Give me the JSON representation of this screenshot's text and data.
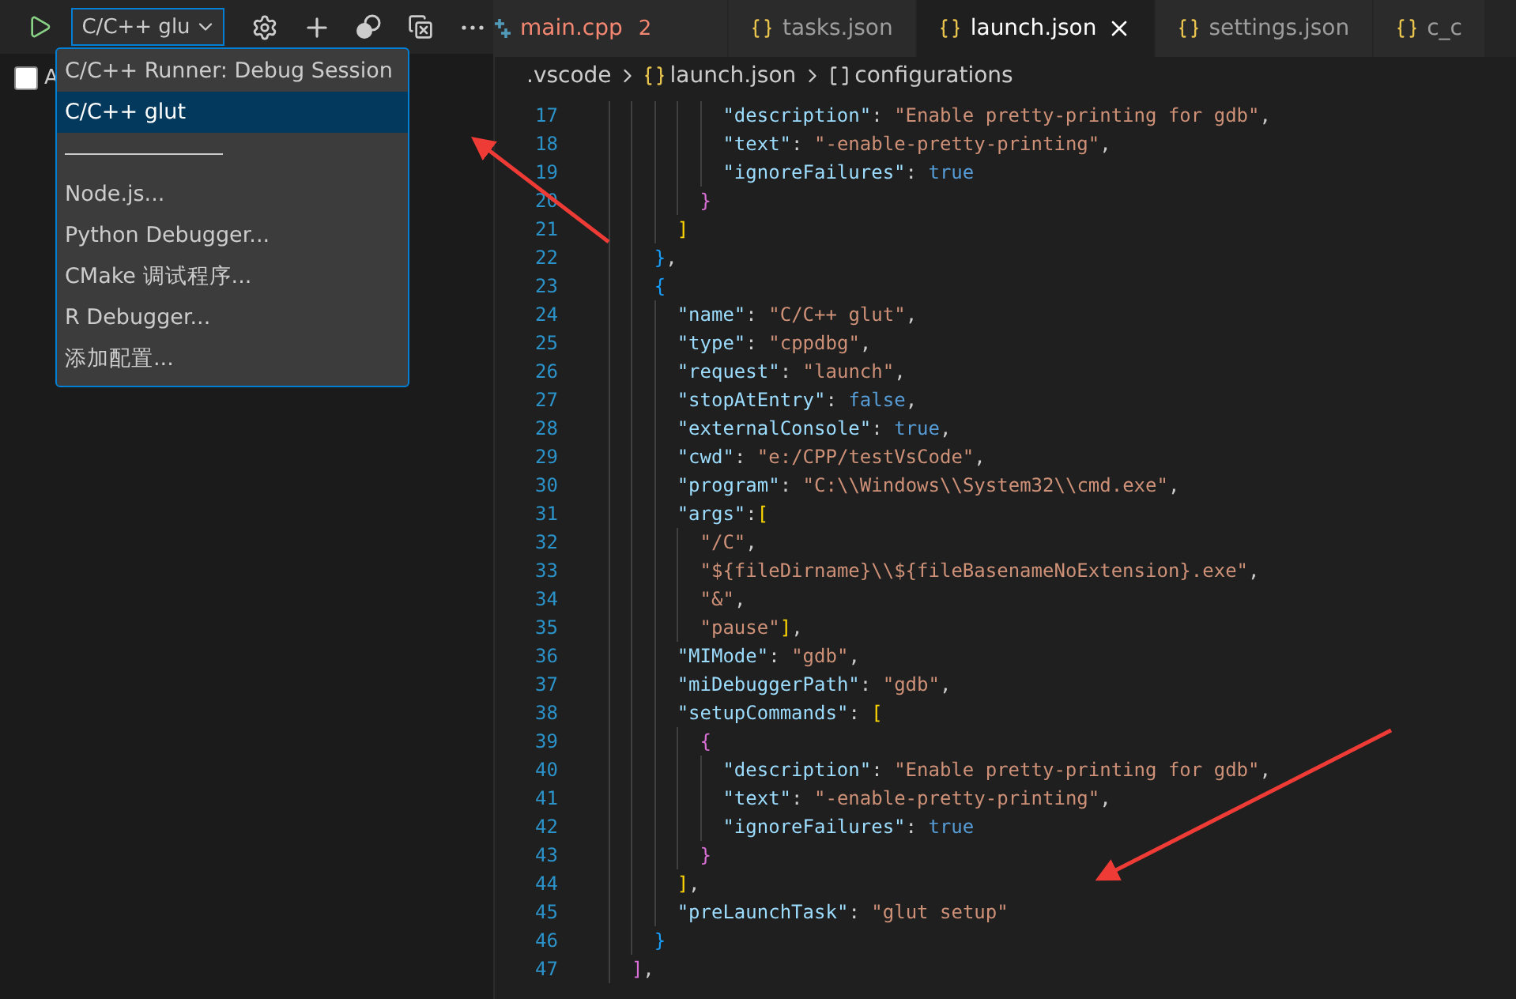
{
  "debug_toolbar": {
    "configuration": "C/C++ glu"
  },
  "sidebar": {
    "checkbox": {
      "label": "A",
      "checked": false
    }
  },
  "config_dropdown": {
    "items": [
      {
        "kind": "option",
        "label": "C/C++ Runner: Debug Session",
        "selected": false
      },
      {
        "kind": "option",
        "label": "C/C++ glut",
        "selected": true
      },
      {
        "kind": "separator"
      },
      {
        "kind": "option",
        "label": "Node.js...",
        "selected": false
      },
      {
        "kind": "option",
        "label": "Python Debugger...",
        "selected": false
      },
      {
        "kind": "option",
        "label": "CMake 调试程序...",
        "selected": false
      },
      {
        "kind": "option",
        "label": "R Debugger...",
        "selected": false
      },
      {
        "kind": "option",
        "label": "添加配置...",
        "selected": false
      }
    ]
  },
  "tabs": [
    {
      "kind": "cpp",
      "label": "main.cpp",
      "badge": "2",
      "error": true,
      "selected": false
    },
    {
      "kind": "json",
      "label": "tasks.json",
      "error": false,
      "selected": false
    },
    {
      "kind": "json",
      "label": "launch.json",
      "error": false,
      "selected": true
    },
    {
      "kind": "json",
      "label": "settings.json",
      "error": false,
      "selected": false
    },
    {
      "kind": "json",
      "label": "c_c",
      "error": false,
      "selected": false
    }
  ],
  "breadcrumb": [
    {
      "kind": "folder",
      "label": ".vscode"
    },
    {
      "kind": "json",
      "label": "launch.json"
    },
    {
      "kind": "array",
      "label": "configurations"
    }
  ],
  "editor": {
    "lines": [
      {
        "number": "17",
        "tokens": [
          {
            "kind": "key",
            "text": "          \"description\""
          },
          {
            "kind": "punct",
            "text": ": "
          },
          {
            "kind": "string",
            "text": "\"Enable pretty-printing for gdb\""
          },
          {
            "kind": "punct",
            "text": ","
          }
        ]
      },
      {
        "number": "18",
        "tokens": [
          {
            "kind": "key",
            "text": "          \"text\""
          },
          {
            "kind": "punct",
            "text": ": "
          },
          {
            "kind": "string",
            "text": "\"-enable-pretty-printing\""
          },
          {
            "kind": "punct",
            "text": ","
          }
        ]
      },
      {
        "number": "19",
        "tokens": [
          {
            "kind": "key",
            "text": "          \"ignoreFailures\""
          },
          {
            "kind": "punct",
            "text": ": "
          },
          {
            "kind": "keyword",
            "text": "true"
          }
        ]
      },
      {
        "number": "20",
        "tokens": [
          {
            "kind": "bracket2",
            "text": "        }"
          }
        ]
      },
      {
        "number": "21",
        "tokens": [
          {
            "kind": "bracket1",
            "text": "      ]"
          }
        ]
      },
      {
        "number": "22",
        "tokens": [
          {
            "kind": "bracket3",
            "text": "    }"
          },
          {
            "kind": "punct",
            "text": ","
          }
        ]
      },
      {
        "number": "23",
        "tokens": [
          {
            "kind": "bracket3",
            "text": "    {"
          }
        ]
      },
      {
        "number": "24",
        "tokens": [
          {
            "kind": "key",
            "text": "      \"name\""
          },
          {
            "kind": "punct",
            "text": ": "
          },
          {
            "kind": "string",
            "text": "\"C/C++ glut\""
          },
          {
            "kind": "punct",
            "text": ","
          }
        ]
      },
      {
        "number": "25",
        "tokens": [
          {
            "kind": "key",
            "text": "      \"type\""
          },
          {
            "kind": "punct",
            "text": ": "
          },
          {
            "kind": "string",
            "text": "\"cppdbg\""
          },
          {
            "kind": "punct",
            "text": ","
          }
        ]
      },
      {
        "number": "26",
        "tokens": [
          {
            "kind": "key",
            "text": "      \"request\""
          },
          {
            "kind": "punct",
            "text": ": "
          },
          {
            "kind": "string",
            "text": "\"launch\""
          },
          {
            "kind": "punct",
            "text": ","
          }
        ]
      },
      {
        "number": "27",
        "tokens": [
          {
            "kind": "key",
            "text": "      \"stopAtEntry\""
          },
          {
            "kind": "punct",
            "text": ": "
          },
          {
            "kind": "keyword",
            "text": "false"
          },
          {
            "kind": "punct",
            "text": ","
          }
        ]
      },
      {
        "number": "28",
        "tokens": [
          {
            "kind": "key",
            "text": "      \"externalConsole\""
          },
          {
            "kind": "punct",
            "text": ": "
          },
          {
            "kind": "keyword",
            "text": "true"
          },
          {
            "kind": "punct",
            "text": ","
          }
        ]
      },
      {
        "number": "29",
        "tokens": [
          {
            "kind": "key",
            "text": "      \"cwd\""
          },
          {
            "kind": "punct",
            "text": ": "
          },
          {
            "kind": "string",
            "text": "\"e:/CPP/testVsCode\""
          },
          {
            "kind": "punct",
            "text": ","
          }
        ]
      },
      {
        "number": "30",
        "tokens": [
          {
            "kind": "key",
            "text": "      \"program\""
          },
          {
            "kind": "punct",
            "text": ": "
          },
          {
            "kind": "string",
            "text": "\"C:\\\\Windows\\\\System32\\\\cmd.exe\""
          },
          {
            "kind": "punct",
            "text": ","
          }
        ]
      },
      {
        "number": "31",
        "tokens": [
          {
            "kind": "key",
            "text": "      \"args\""
          },
          {
            "kind": "punct",
            "text": ":"
          },
          {
            "kind": "bracket1",
            "text": "["
          }
        ]
      },
      {
        "number": "32",
        "tokens": [
          {
            "kind": "string",
            "text": "        \"/C\""
          },
          {
            "kind": "punct",
            "text": ","
          }
        ]
      },
      {
        "number": "33",
        "tokens": [
          {
            "kind": "string",
            "text": "        \"${fileDirname}\\\\${fileBasenameNoExtension}.exe\""
          },
          {
            "kind": "punct",
            "text": ","
          }
        ]
      },
      {
        "number": "34",
        "tokens": [
          {
            "kind": "string",
            "text": "        \"&\""
          },
          {
            "kind": "punct",
            "text": ","
          }
        ]
      },
      {
        "number": "35",
        "tokens": [
          {
            "kind": "string",
            "text": "        \"pause\""
          },
          {
            "kind": "bracket1",
            "text": "]"
          },
          {
            "kind": "punct",
            "text": ","
          }
        ]
      },
      {
        "number": "36",
        "tokens": [
          {
            "kind": "key",
            "text": "      \"MIMode\""
          },
          {
            "kind": "punct",
            "text": ": "
          },
          {
            "kind": "string",
            "text": "\"gdb\""
          },
          {
            "kind": "punct",
            "text": ","
          }
        ]
      },
      {
        "number": "37",
        "tokens": [
          {
            "kind": "key",
            "text": "      \"miDebuggerPath\""
          },
          {
            "kind": "punct",
            "text": ": "
          },
          {
            "kind": "string",
            "text": "\"gdb\""
          },
          {
            "kind": "punct",
            "text": ","
          }
        ]
      },
      {
        "number": "38",
        "tokens": [
          {
            "kind": "key",
            "text": "      \"setupCommands\""
          },
          {
            "kind": "punct",
            "text": ": "
          },
          {
            "kind": "bracket1",
            "text": "["
          }
        ]
      },
      {
        "number": "39",
        "tokens": [
          {
            "kind": "bracket2",
            "text": "        {"
          }
        ]
      },
      {
        "number": "40",
        "tokens": [
          {
            "kind": "key",
            "text": "          \"description\""
          },
          {
            "kind": "punct",
            "text": ": "
          },
          {
            "kind": "string",
            "text": "\"Enable pretty-printing for gdb\""
          },
          {
            "kind": "punct",
            "text": ","
          }
        ]
      },
      {
        "number": "41",
        "tokens": [
          {
            "kind": "key",
            "text": "          \"text\""
          },
          {
            "kind": "punct",
            "text": ": "
          },
          {
            "kind": "string",
            "text": "\"-enable-pretty-printing\""
          },
          {
            "kind": "punct",
            "text": ","
          }
        ]
      },
      {
        "number": "42",
        "tokens": [
          {
            "kind": "key",
            "text": "          \"ignoreFailures\""
          },
          {
            "kind": "punct",
            "text": ": "
          },
          {
            "kind": "keyword",
            "text": "true"
          }
        ]
      },
      {
        "number": "43",
        "tokens": [
          {
            "kind": "bracket2",
            "text": "        }"
          }
        ]
      },
      {
        "number": "44",
        "tokens": [
          {
            "kind": "bracket1",
            "text": "      ]"
          },
          {
            "kind": "punct",
            "text": ","
          }
        ]
      },
      {
        "number": "45",
        "tokens": [
          {
            "kind": "key",
            "text": "      \"preLaunchTask\""
          },
          {
            "kind": "punct",
            "text": ": "
          },
          {
            "kind": "string",
            "text": "\"glut setup\""
          }
        ]
      },
      {
        "number": "46",
        "tokens": [
          {
            "kind": "bracket3",
            "text": "    }"
          }
        ]
      },
      {
        "number": "47",
        "tokens": [
          {
            "kind": "bracket2",
            "text": "  ]"
          },
          {
            "kind": "punct",
            "text": ","
          }
        ]
      }
    ]
  }
}
